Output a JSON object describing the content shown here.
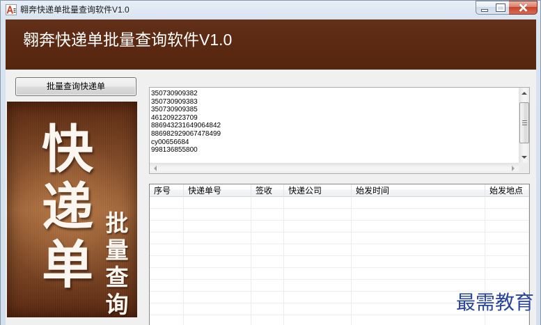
{
  "window": {
    "title": "翱奔快递单批量查询软件V1.0",
    "icon": "app-icon",
    "controls": [
      "minimize-icon",
      "maximize-icon",
      "close-icon"
    ]
  },
  "header": {
    "title": "翱奔快递单批量查询软件V1.0"
  },
  "sidebar": {
    "query_button_label": "批量查询快递单",
    "banner": {
      "main": [
        "快",
        "递",
        "单"
      ],
      "sub": [
        "批",
        "量",
        "查",
        "询"
      ]
    }
  },
  "tracking_input": {
    "value": "350730909382\n350730909383\n350730909385\n461209223709\n886943231649064842\n886982929067478499\ncy00656684\n998136855800",
    "scrollbar_icons": [
      "up-arrow-icon",
      "down-arrow-icon",
      "left-arrow-icon",
      "right-arrow-icon"
    ]
  },
  "results_table": {
    "columns": [
      "序号",
      "快递单号",
      "签收",
      "快递公司",
      "始发时间",
      "始发地点"
    ],
    "rows": []
  },
  "watermark": "最需教育",
  "colors": {
    "header_bg": "#5c2a12",
    "header_text": "#ffffff",
    "banner_dark": "#5a2810",
    "banner_light": "#a0663a",
    "banner_text": "#fbf7f0",
    "watermark": "#2a469c",
    "close_button": "#c8432b"
  }
}
